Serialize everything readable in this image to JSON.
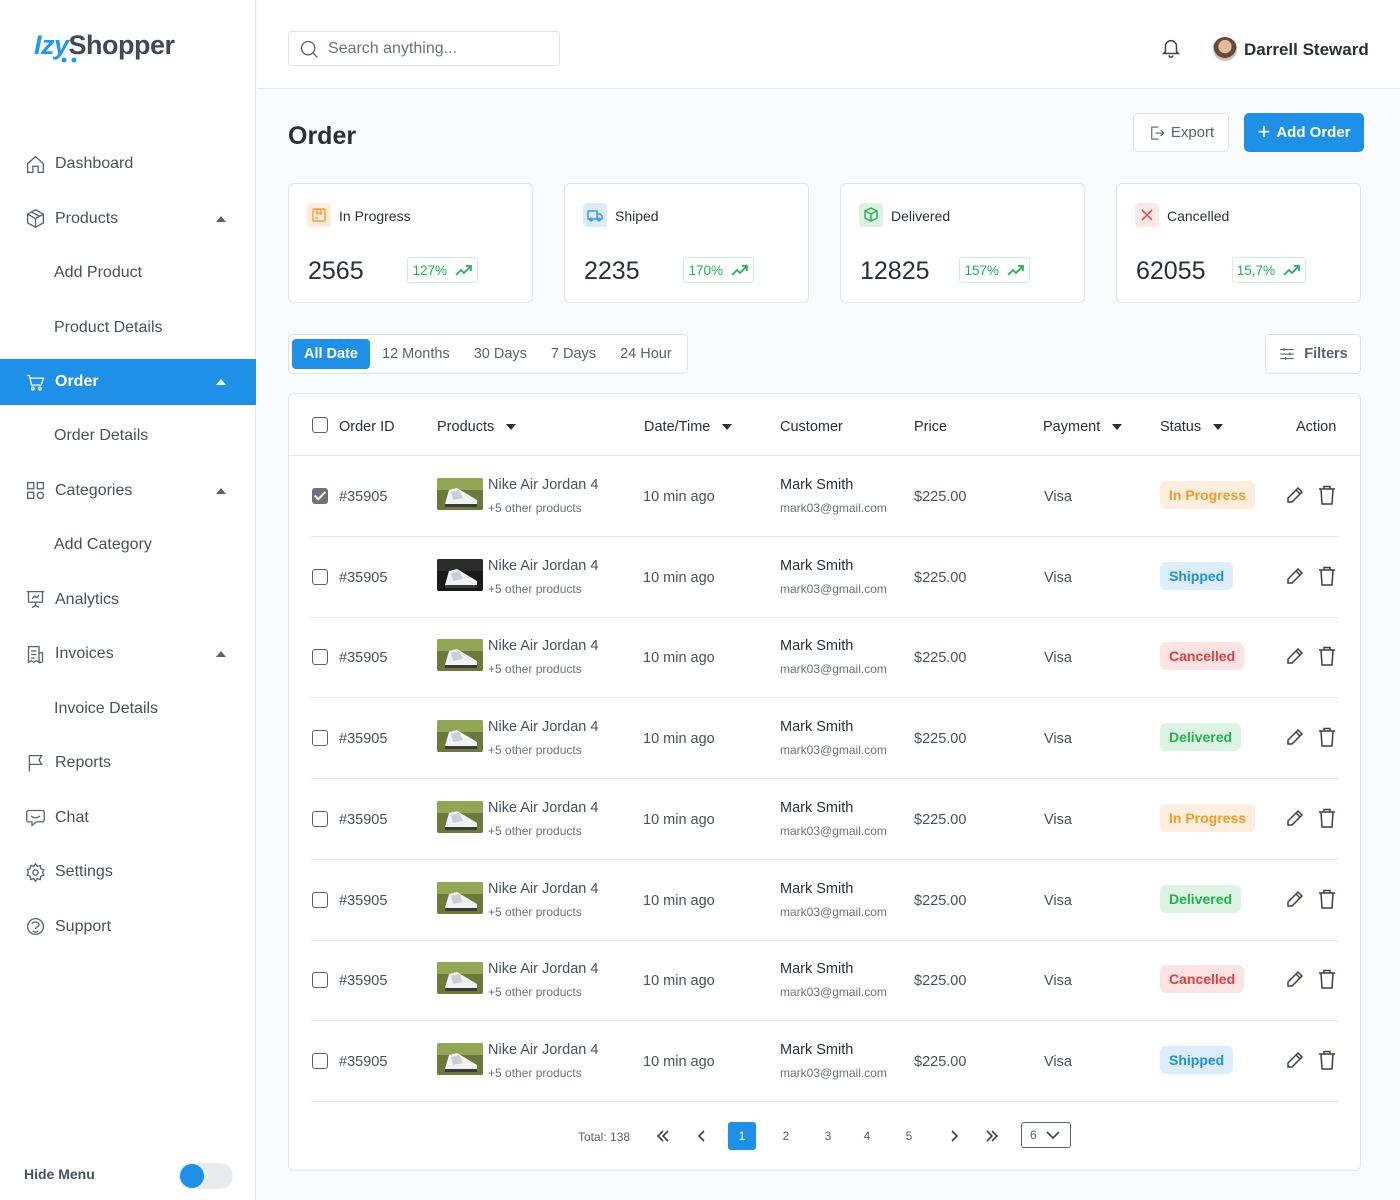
{
  "brand": {
    "logo_prefix": "Izy",
    "logo_suffix": "Shopper"
  },
  "sidebar": {
    "items": [
      {
        "label": "Dashboard"
      },
      {
        "label": "Products"
      },
      {
        "label": "Add Product"
      },
      {
        "label": "Product Details"
      },
      {
        "label": "Order"
      },
      {
        "label": "Order Details"
      },
      {
        "label": "Categories"
      },
      {
        "label": "Add Category"
      },
      {
        "label": "Analytics"
      },
      {
        "label": "Invoices"
      },
      {
        "label": "Invoice Details"
      },
      {
        "label": "Reports"
      },
      {
        "label": "Chat"
      },
      {
        "label": "Settings"
      },
      {
        "label": "Support"
      }
    ],
    "hide_menu_label": "Hide Menu",
    "hide_menu_on": true
  },
  "header": {
    "search_placeholder": "Search anything...",
    "user_name": "Darrell Steward"
  },
  "page": {
    "title": "Order",
    "export_label": "Export",
    "add_label": "Add Order"
  },
  "stats": [
    {
      "label": "In Progress",
      "value": "2565",
      "change": "127%",
      "icon": "box-icon",
      "color": "#f5a140",
      "bg": "#fdecd9"
    },
    {
      "label": "Shiped",
      "value": "2235",
      "change": "170%",
      "icon": "truck-icon",
      "color": "#3a9be8",
      "bg": "#dcebfa"
    },
    {
      "label": "Delivered",
      "value": "12825",
      "change": "157%",
      "icon": "package-check-icon",
      "color": "#2fb457",
      "bg": "#dcf3e3"
    },
    {
      "label": "Cancelled",
      "value": "62055",
      "change": "15,7%",
      "icon": "close-icon",
      "color": "#e84545",
      "bg": "#fde7e7"
    }
  ],
  "date_filter": {
    "options": [
      "All Date",
      "12 Months",
      "30 Days",
      "7 Days",
      "24 Hour"
    ],
    "selected": "All Date"
  },
  "filters_label": "Filters",
  "table": {
    "columns": [
      "Order ID",
      "Products",
      "Date/Time",
      "Customer",
      "Price",
      "Payment",
      "Status",
      "Action"
    ],
    "rows": [
      {
        "id": "#35905",
        "product": "Nike Air Jordan 4",
        "more": "+5 other products",
        "time": "10 min ago",
        "customer": "Mark Smith",
        "email": "mark03@gmail.com",
        "price": "$225.00",
        "payment": "Visa",
        "status": "In Progress",
        "checked": true
      },
      {
        "id": "#35905",
        "product": "Nike Air Jordan 4",
        "more": "+5 other products",
        "time": "10 min ago",
        "customer": "Mark Smith",
        "email": "mark03@gmail.com",
        "price": "$225.00",
        "payment": "Visa",
        "status": "Shipped",
        "checked": false
      },
      {
        "id": "#35905",
        "product": "Nike Air Jordan 4",
        "more": "+5 other products",
        "time": "10 min ago",
        "customer": "Mark Smith",
        "email": "mark03@gmail.com",
        "price": "$225.00",
        "payment": "Visa",
        "status": "Cancelled",
        "checked": false
      },
      {
        "id": "#35905",
        "product": "Nike Air Jordan 4",
        "more": "+5 other products",
        "time": "10 min ago",
        "customer": "Mark Smith",
        "email": "mark03@gmail.com",
        "price": "$225.00",
        "payment": "Visa",
        "status": "Delivered",
        "checked": false
      },
      {
        "id": "#35905",
        "product": "Nike Air Jordan 4",
        "more": "+5 other products",
        "time": "10 min ago",
        "customer": "Mark Smith",
        "email": "mark03@gmail.com",
        "price": "$225.00",
        "payment": "Visa",
        "status": "In Progress",
        "checked": false
      },
      {
        "id": "#35905",
        "product": "Nike Air Jordan 4",
        "more": "+5 other products",
        "time": "10 min ago",
        "customer": "Mark Smith",
        "email": "mark03@gmail.com",
        "price": "$225.00",
        "payment": "Visa",
        "status": "Delivered",
        "checked": false
      },
      {
        "id": "#35905",
        "product": "Nike Air Jordan 4",
        "more": "+5 other products",
        "time": "10 min ago",
        "customer": "Mark Smith",
        "email": "mark03@gmail.com",
        "price": "$225.00",
        "payment": "Visa",
        "status": "Cancelled",
        "checked": false
      },
      {
        "id": "#35905",
        "product": "Nike Air Jordan 4",
        "more": "+5 other products",
        "time": "10 min ago",
        "customer": "Mark Smith",
        "email": "mark03@gmail.com",
        "price": "$225.00",
        "payment": "Visa",
        "status": "Shipped",
        "checked": false
      }
    ]
  },
  "status_colors": {
    "In Progress": {
      "fg": "#f39a2b",
      "bg": "#fdeedd"
    },
    "Shipped": {
      "fg": "#1f8fe0",
      "bg": "#dcedfb"
    },
    "Cancelled": {
      "fg": "#e0403f",
      "bg": "#fde3e3"
    },
    "Delivered": {
      "fg": "#23b24c",
      "bg": "#ddf4e4"
    }
  },
  "pagination": {
    "total_label": "Total: 138",
    "pages": [
      "1",
      "2",
      "3",
      "4",
      "5"
    ],
    "current": "1",
    "per_page": "6"
  }
}
